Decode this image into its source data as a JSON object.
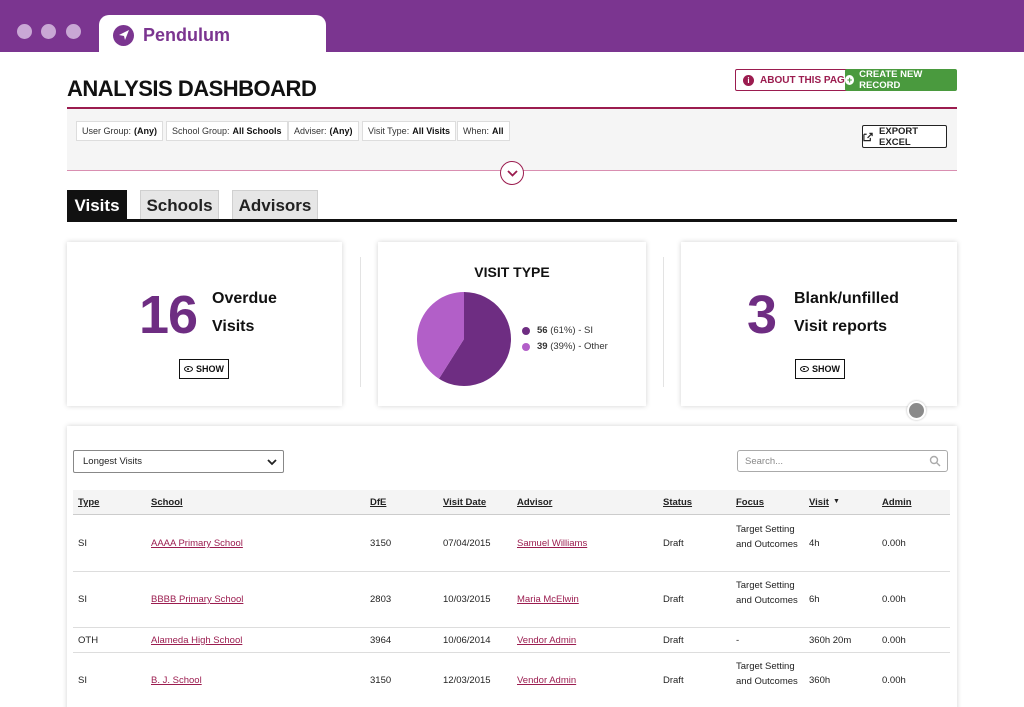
{
  "browser": {
    "tab_title": "Pendulum"
  },
  "header": {
    "title": "ANALYSIS DASHBOARD",
    "about_label": "ABOUT THIS PAGE",
    "create_label": "CREATE NEW RECORD"
  },
  "filters": [
    {
      "label": "User Group:",
      "value": "(Any)"
    },
    {
      "label": "School Group:",
      "value": "All Schools"
    },
    {
      "label": "Adviser:",
      "value": "(Any)"
    },
    {
      "label": "Visit Type:",
      "value": "All Visits"
    },
    {
      "label": "When:",
      "value": "All"
    }
  ],
  "export_label": "EXPORT EXCEL",
  "tabs": [
    {
      "label": "Visits",
      "active": true
    },
    {
      "label": "Schools",
      "active": false
    },
    {
      "label": "Advisors",
      "active": false
    }
  ],
  "cards": {
    "overdue": {
      "number": "16",
      "line1": "Overdue",
      "line2": "Visits",
      "show_label": "SHOW"
    },
    "visit_type": {
      "title": "VISIT TYPE",
      "legend": [
        {
          "count": "56",
          "detail": "(61%) - SI",
          "color": "#6e2d82"
        },
        {
          "count": "39",
          "detail": "(39%) - Other",
          "color": "#b25fc8"
        }
      ]
    },
    "blank": {
      "number": "3",
      "line1": "Blank/unfilled",
      "line2": "Visit reports",
      "show_label": "SHOW"
    }
  },
  "chart_data": {
    "type": "pie",
    "title": "VISIT TYPE",
    "categories": [
      "SI",
      "Other"
    ],
    "values": [
      56,
      39
    ],
    "percentages": [
      61,
      39
    ],
    "colors": [
      "#6e2d82",
      "#b25fc8"
    ],
    "legend_placement": "right"
  },
  "table": {
    "sort_select": "Longest Visits",
    "search_placeholder": "Search...",
    "sort_indicator": "▼",
    "columns": [
      "Type",
      "School",
      "DfE",
      "Visit Date",
      "Advisor",
      "Status",
      "Focus",
      "Visit",
      "Admin"
    ],
    "rows": [
      [
        "SI",
        "AAAA Primary School",
        "3150",
        "07/04/2015",
        "Samuel Williams",
        "Draft",
        "Target Setting and Outcomes",
        "4h",
        "0.00h"
      ],
      [
        "SI",
        "BBBB Primary School",
        "2803",
        "10/03/2015",
        "Maria McElwin",
        "Draft",
        "Target Setting and Outcomes",
        "6h",
        "0.00h"
      ],
      [
        "OTH",
        "Alameda High School",
        "3964",
        "10/06/2014",
        "Vendor Admin",
        "Draft",
        "-",
        "360h 20m",
        "0.00h"
      ],
      [
        "SI",
        "B. J. School",
        "3150",
        "12/03/2015",
        "Vendor Admin",
        "Draft",
        "Target Setting and Outcomes",
        "360h",
        "0.00h"
      ]
    ]
  }
}
